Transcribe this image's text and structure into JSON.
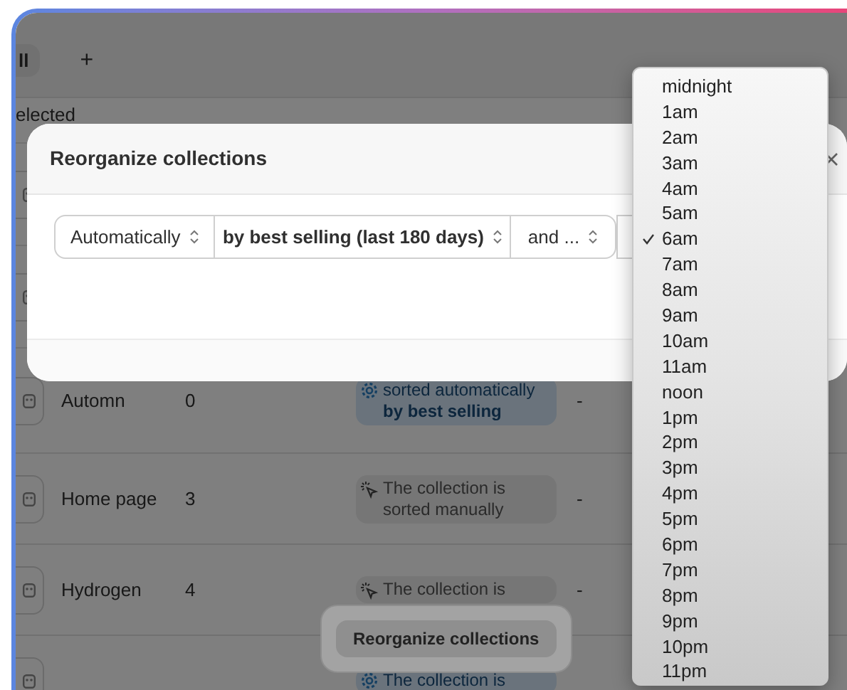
{
  "tabs": [
    {
      "label": "ll",
      "selected": true
    },
    {
      "label": "+",
      "selected": false
    }
  ],
  "selection_text": "elected",
  "rows": [
    {
      "kind": "covered"
    },
    {
      "kind": "covered"
    },
    {
      "kind": "automatic",
      "name": "Automn",
      "count": "0",
      "sort_text": "sorted automatically **by best selling**",
      "last": "-"
    },
    {
      "kind": "manual",
      "name": "Home page",
      "count": "3",
      "sort_text": "The collection is sorted manually",
      "last": "-"
    },
    {
      "kind": "manual",
      "name": "Hydrogen",
      "count": "4",
      "sort_text": "The collection is",
      "last": "-"
    },
    {
      "kind": "automatic",
      "sort_text": "The collection is"
    }
  ],
  "floating_button": "Reorganize collections",
  "modal": {
    "title": "Reorganize collections",
    "selects": [
      {
        "value": "Automatically",
        "emphasis": false
      },
      {
        "value": "by best selling (last 180 days)",
        "emphasis": true
      },
      {
        "value": "and ...",
        "emphasis": false
      }
    ]
  },
  "dropdown": {
    "options": [
      {
        "label": "midnight",
        "selected": false
      },
      {
        "label": "1am",
        "selected": false
      },
      {
        "label": "2am",
        "selected": false
      },
      {
        "label": "3am",
        "selected": false
      },
      {
        "label": "4am",
        "selected": false
      },
      {
        "label": "5am",
        "selected": false
      },
      {
        "label": "6am",
        "selected": true
      },
      {
        "label": "7am",
        "selected": false
      },
      {
        "label": "8am",
        "selected": false
      },
      {
        "label": "9am",
        "selected": false
      },
      {
        "label": "10am",
        "selected": false
      },
      {
        "label": "11am",
        "selected": false
      },
      {
        "label": "noon",
        "selected": false
      },
      {
        "label": "1pm",
        "selected": false
      },
      {
        "label": "2pm",
        "selected": false
      },
      {
        "label": "3pm",
        "selected": false
      },
      {
        "label": "4pm",
        "selected": false
      },
      {
        "label": "5pm",
        "selected": false
      },
      {
        "label": "6pm",
        "selected": false
      },
      {
        "label": "7pm",
        "selected": false
      },
      {
        "label": "8pm",
        "selected": false
      },
      {
        "label": "9pm",
        "selected": false
      },
      {
        "label": "10pm",
        "selected": false
      },
      {
        "label": "11pm",
        "selected": false
      }
    ]
  }
}
